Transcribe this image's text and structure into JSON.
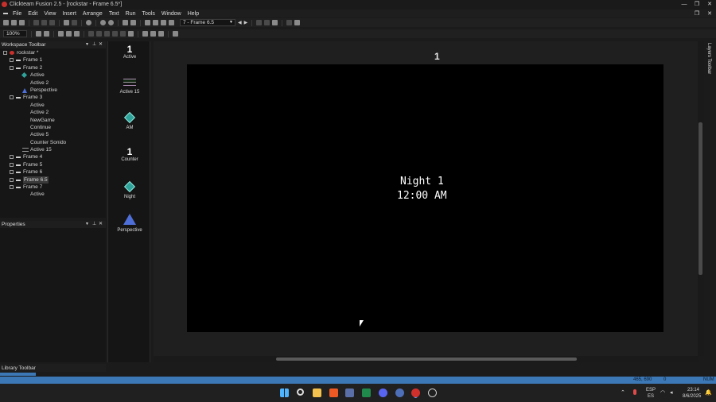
{
  "window": {
    "title": "Clickteam Fusion 2.5 - [rockstar - Frame 6.5*]"
  },
  "menu": [
    "File",
    "Edit",
    "View",
    "Insert",
    "Arrange",
    "Text",
    "Run",
    "Tools",
    "Window",
    "Help"
  ],
  "toolbar": {
    "frame_select": "7 - Frame 6.5",
    "zoom": "100%"
  },
  "workspace": {
    "title": "Workspace Toolbar",
    "tree": [
      {
        "label": "rockstar *",
        "level": 0,
        "icon": "app-icon"
      },
      {
        "label": "Frame 1",
        "level": 1,
        "icon": "frame-icon"
      },
      {
        "label": "Frame 2",
        "level": 1,
        "icon": "frame-icon"
      },
      {
        "label": "Active",
        "level": 2,
        "icon": "diamond-icon"
      },
      {
        "label": "Active 2",
        "level": 2,
        "icon": "none"
      },
      {
        "label": "Perspective",
        "level": 2,
        "icon": "perspective-icon"
      },
      {
        "label": "Frame 3",
        "level": 1,
        "icon": "frame-icon"
      },
      {
        "label": "Active",
        "level": 2,
        "icon": "none"
      },
      {
        "label": "Active 2",
        "level": 2,
        "icon": "none"
      },
      {
        "label": "NewGame",
        "level": 2,
        "icon": "none"
      },
      {
        "label": "Continue",
        "level": 2,
        "icon": "none"
      },
      {
        "label": "Active 5",
        "level": 2,
        "icon": "none"
      },
      {
        "label": "Counter Sonido",
        "level": 2,
        "icon": "none"
      },
      {
        "label": "Active 15",
        "level": 2,
        "icon": "bars-icon"
      },
      {
        "label": "Frame 4",
        "level": 1,
        "icon": "frame-icon"
      },
      {
        "label": "Frame 5",
        "level": 1,
        "icon": "frame-icon"
      },
      {
        "label": "Frame 6",
        "level": 1,
        "icon": "frame-icon"
      },
      {
        "label": "Frame 6.5",
        "level": 1,
        "icon": "frame-icon",
        "selected": true
      },
      {
        "label": "Frame 7",
        "level": 1,
        "icon": "frame-icon"
      },
      {
        "label": "Active",
        "level": 2,
        "icon": "none"
      }
    ]
  },
  "properties": {
    "title": "Properties"
  },
  "library": {
    "title": "Library Toolbar"
  },
  "objects": [
    {
      "label": "Active",
      "icon": "counter-one-icon",
      "glyph": "1"
    },
    {
      "label": "Active 15",
      "icon": "bars-icon",
      "glyph": ""
    },
    {
      "label": "AM",
      "icon": "diamond-icon",
      "glyph": ""
    },
    {
      "label": "Counter",
      "icon": "counter-one-icon",
      "glyph": "1"
    },
    {
      "label": "Night",
      "icon": "diamond-icon",
      "glyph": ""
    },
    {
      "label": "Perspective",
      "icon": "perspective-icon",
      "glyph": ""
    }
  ],
  "editor": {
    "counter_above": "1",
    "night_text": "Night 1",
    "time_text": "12:00 AM"
  },
  "layers": {
    "title": "Layers Toolbar"
  },
  "status": {
    "coords": "465, 690",
    "zero": "0",
    "num": "NUM"
  },
  "taskbar": {
    "lang_top": "ESP",
    "lang_bottom": "ES",
    "time": "23:14",
    "date": "8/6/2025"
  },
  "colors": {
    "status_blue": "#3c78b6",
    "stage": "#000000",
    "diamond": "#2fa39a"
  }
}
